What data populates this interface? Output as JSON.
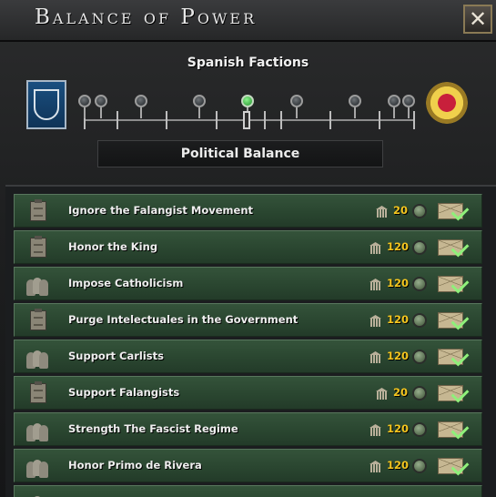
{
  "window": {
    "title": "Balance of Power",
    "close_label": "✕"
  },
  "balance": {
    "subtitle": "Spanish Factions",
    "label": "Political Balance",
    "left_faction_icon": "falange-yoke-arrows-icon",
    "right_faction_icon": "sacred-heart-sun-icon",
    "active_pin_index": 4,
    "pin_count": 8,
    "colors": {
      "active_pin": "#3fbf4a",
      "cost_text": "#f4c51e",
      "row_green": "#2a4630"
    }
  },
  "decisions": [
    {
      "label": "Ignore the Falangist Movement",
      "cost": "20",
      "icon": "clipboard-icon"
    },
    {
      "label": "Honor the King",
      "cost": "120",
      "icon": "clipboard-icon"
    },
    {
      "label": "Impose Catholicism",
      "cost": "120",
      "icon": "people-icon"
    },
    {
      "label": "Purge Intelectuales in the Government",
      "cost": "120",
      "icon": "clipboard-icon"
    },
    {
      "label": "Support Carlists",
      "cost": "120",
      "icon": "people-icon"
    },
    {
      "label": "Support Falangists",
      "cost": "20",
      "icon": "clipboard-icon"
    },
    {
      "label": "Strength The Fascist Regime",
      "cost": "120",
      "icon": "people-icon"
    },
    {
      "label": "Honor Primo de Rivera",
      "cost": "120",
      "icon": "people-icon"
    }
  ]
}
